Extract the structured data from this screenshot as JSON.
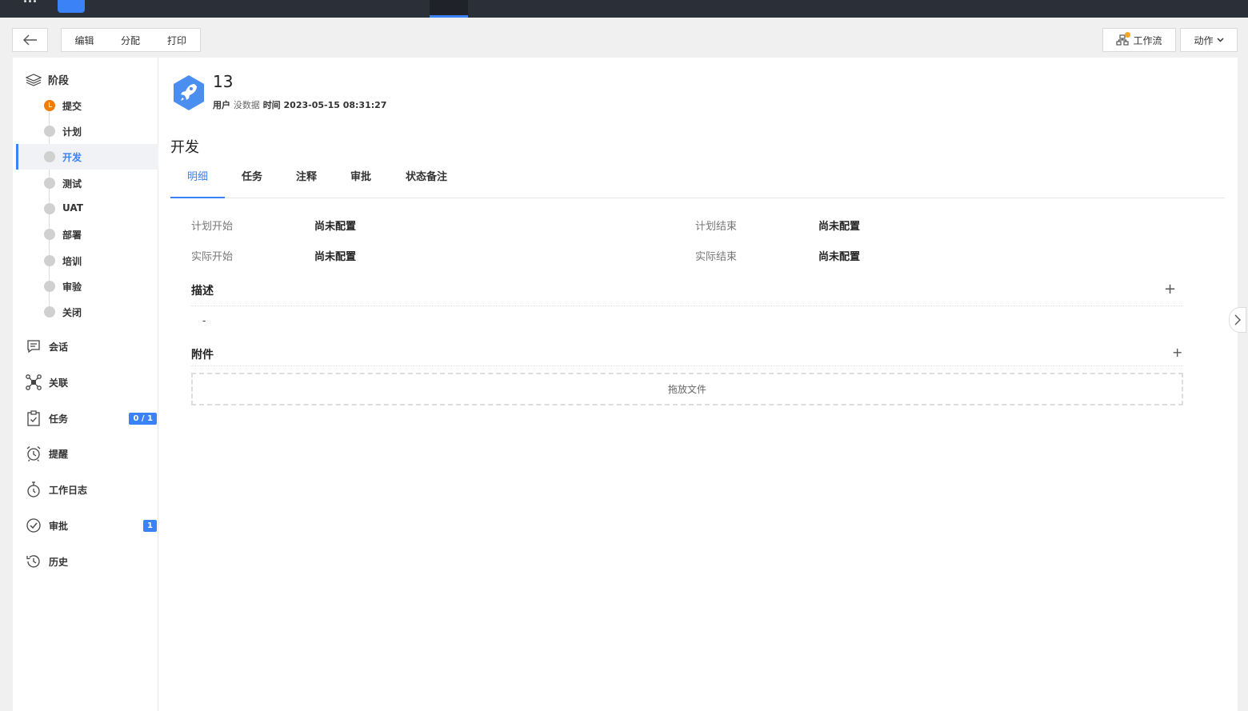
{
  "toolbar": {
    "edit_label": "编辑",
    "assign_label": "分配",
    "print_label": "打印",
    "workflow_label": "工作流",
    "action_label": "动作"
  },
  "record": {
    "number": "13",
    "user_label": "用户",
    "user_value": "没数据",
    "time_label": "时间",
    "time_value": "2023-05-15 08:31:27",
    "current_stage": "开发"
  },
  "sidebar": {
    "stage_header": "阶段",
    "stages": [
      {
        "label": "提交",
        "status": "done"
      },
      {
        "label": "计划",
        "status": "pending"
      },
      {
        "label": "开发",
        "status": "active"
      },
      {
        "label": "测试",
        "status": "pending"
      },
      {
        "label": "UAT",
        "status": "pending"
      },
      {
        "label": "部署",
        "status": "pending"
      },
      {
        "label": "培训",
        "status": "pending"
      },
      {
        "label": "审验",
        "status": "pending"
      },
      {
        "label": "关闭",
        "status": "pending"
      }
    ],
    "menu": [
      {
        "label": "会话",
        "icon": "chat-icon"
      },
      {
        "label": "关联",
        "icon": "link-network-icon"
      },
      {
        "label": "任务",
        "icon": "clipboard-check-icon",
        "badge": "0 / 1"
      },
      {
        "label": "提醒",
        "icon": "alarm-clock-icon"
      },
      {
        "label": "工作日志",
        "icon": "stopwatch-icon"
      },
      {
        "label": "审批",
        "icon": "check-circle-icon",
        "badge": "1"
      },
      {
        "label": "历史",
        "icon": "history-icon"
      }
    ]
  },
  "tabs": [
    "明细",
    "任务",
    "注释",
    "审批",
    "状态备注"
  ],
  "details": {
    "plan_start_label": "计划开始",
    "plan_start_value": "尚未配置",
    "plan_end_label": "计划结束",
    "plan_end_value": "尚未配置",
    "actual_start_label": "实际开始",
    "actual_start_value": "尚未配置",
    "actual_end_label": "实际结束",
    "actual_end_value": "尚未配置"
  },
  "description": {
    "title": "描述",
    "value": "-"
  },
  "attachments": {
    "title": "附件",
    "dropzone": "拖放文件"
  },
  "colors": {
    "accent": "#3b82f6",
    "done": "#f57c00",
    "nav": "#2b3038"
  }
}
